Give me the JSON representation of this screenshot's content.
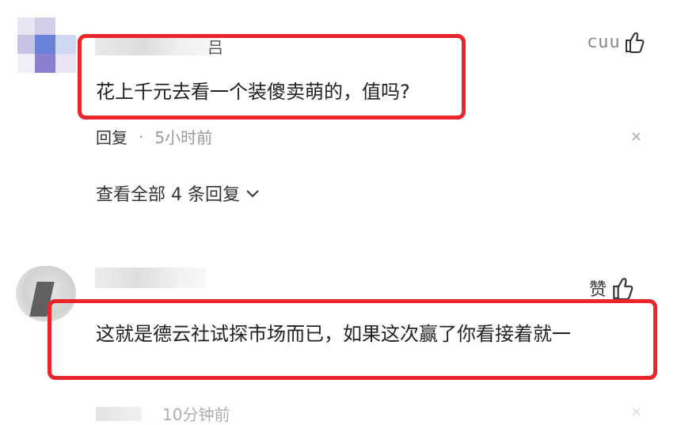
{
  "comment1": {
    "username_suffix": "吕",
    "like_count": "ⅽuu",
    "text": "花上千元去看一个装傻卖萌的，值吗?",
    "reply_label": "回复",
    "separator": "·",
    "time": "5小时前",
    "close_symbol": "×",
    "view_all_label": "查看全部 4 条回复",
    "chevron": "⌄"
  },
  "comment2": {
    "like_label": "赞",
    "text": "这就是德云社试探市场而已，如果这次赢了你看接着就一",
    "time": "10分钟前",
    "close_symbol": "×"
  },
  "colors": {
    "highlight_frame": "#e8262b",
    "muted_text": "#999999"
  },
  "icons": {
    "like": "thumbs-up-icon",
    "close": "close-icon",
    "expand": "chevron-down-icon"
  }
}
